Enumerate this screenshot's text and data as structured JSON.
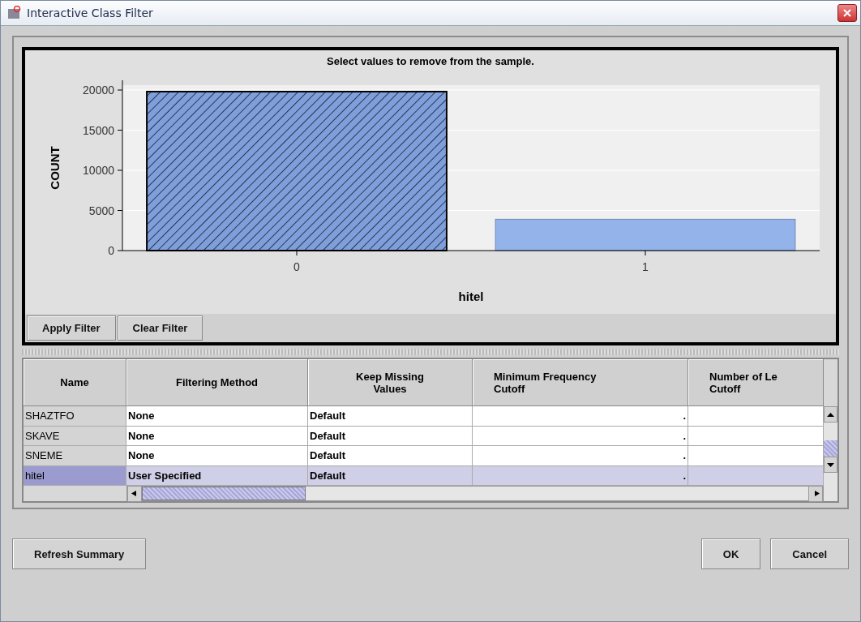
{
  "window": {
    "title": "Interactive Class Filter"
  },
  "chart_panel": {
    "chart_data": {
      "type": "bar",
      "title": "Select values to remove from the sample.",
      "xlabel": "hitel",
      "ylabel": "COUNT",
      "categories": [
        "0",
        "1"
      ],
      "values": [
        19800,
        3900
      ],
      "grid": true,
      "ylim": [
        0,
        20000
      ],
      "yticks": [
        0,
        5000,
        10000,
        15000,
        20000
      ]
    },
    "bars": [
      {
        "selected": true
      },
      {
        "selected": false
      }
    ],
    "buttons": [
      {
        "label": "Apply Filter"
      },
      {
        "label": "Clear Filter"
      }
    ]
  },
  "table": {
    "columns": [
      "Name",
      "Filtering Method",
      "Keep Missing Values",
      "Minimum Frequency Cutoff",
      "Number of Le Cutoff"
    ],
    "rows": [
      {
        "name": "SHAZTFO",
        "method": "None",
        "keep_missing": "Default",
        "min_freq": ".",
        "selected": false
      },
      {
        "name": "SKAVE",
        "method": "None",
        "keep_missing": "Default",
        "min_freq": ".",
        "selected": false
      },
      {
        "name": "SNEME",
        "method": "None",
        "keep_missing": "Default",
        "min_freq": ".",
        "selected": false
      },
      {
        "name": "hitel",
        "method": "User Specified",
        "keep_missing": "Default",
        "min_freq": ".",
        "selected": true
      }
    ]
  },
  "footer": {
    "left_buttons": [
      "Refresh Summary"
    ],
    "right_buttons": [
      "OK",
      "Cancel"
    ]
  }
}
